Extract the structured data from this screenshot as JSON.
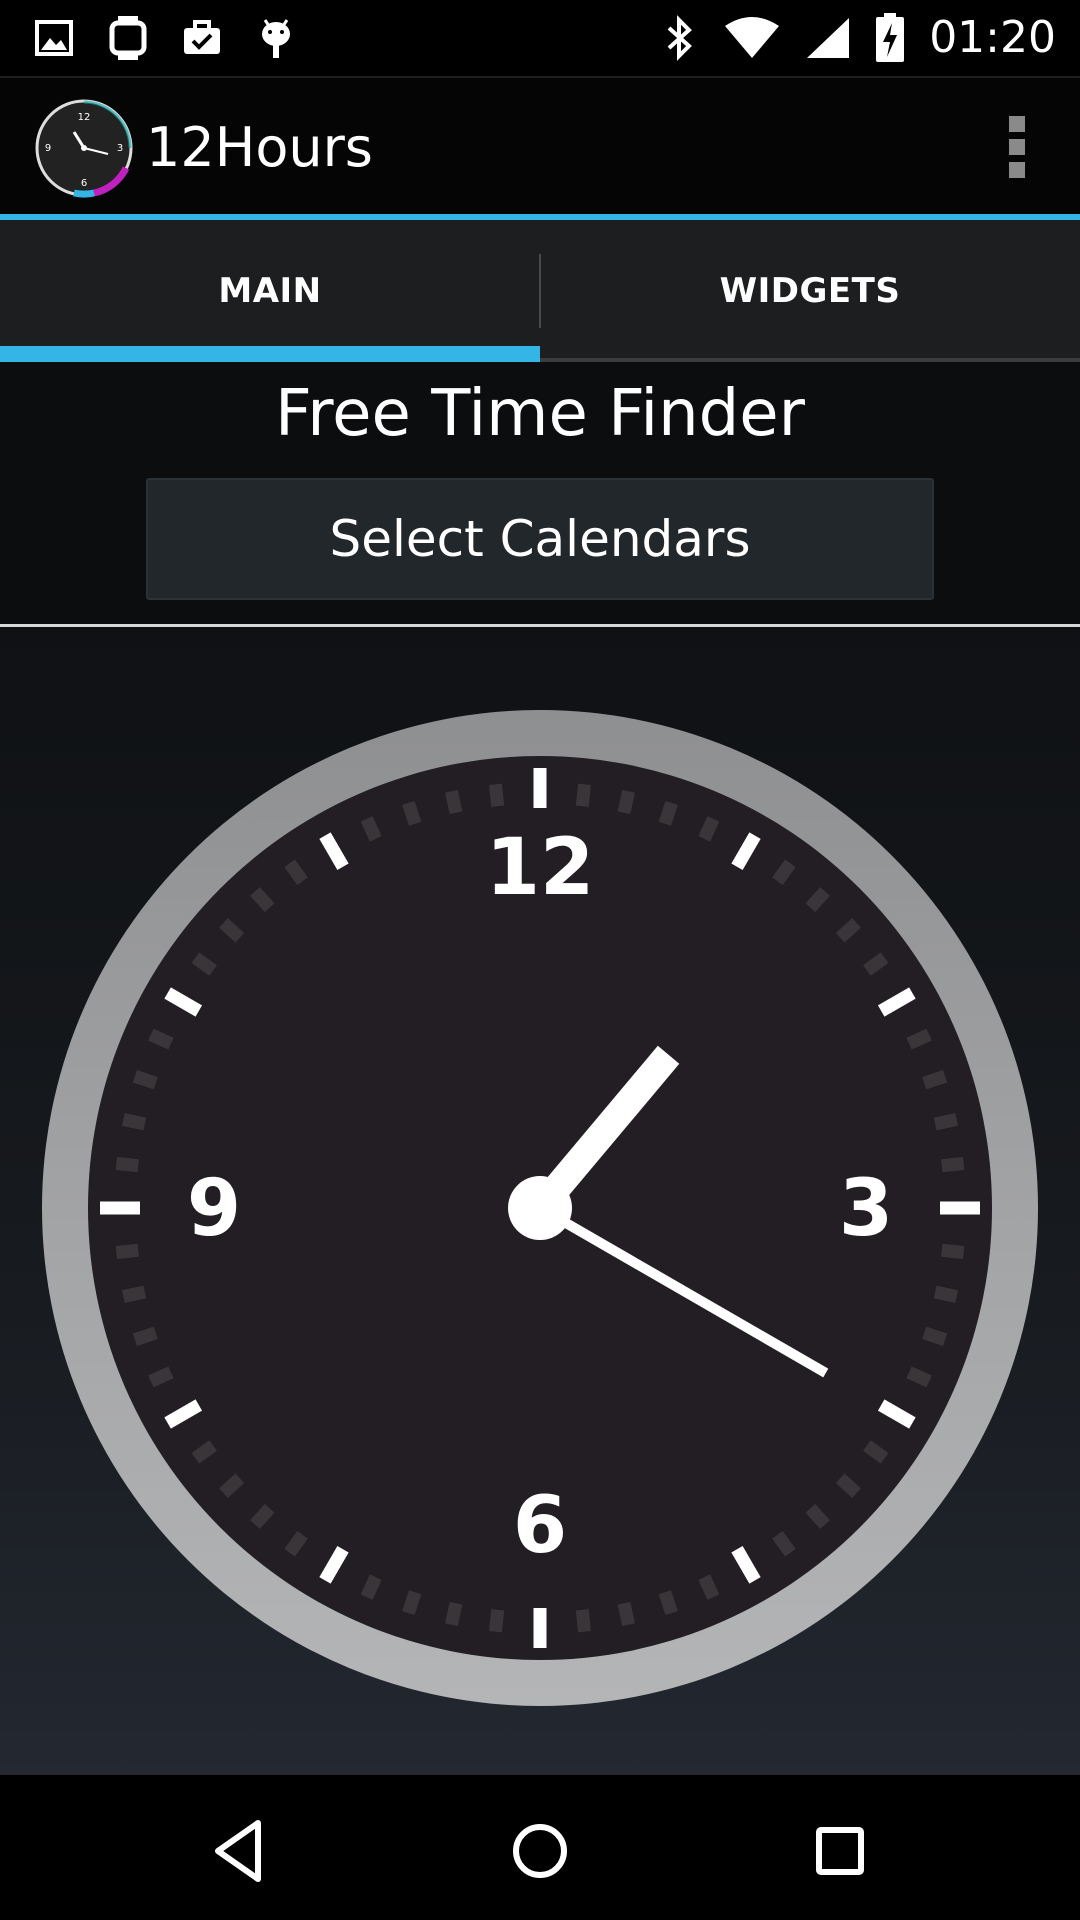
{
  "status_bar": {
    "time": "01:20",
    "left_icons": [
      "image-icon",
      "watch-icon",
      "briefcase-check-icon",
      "android-debug-icon"
    ],
    "right_icons": [
      "bluetooth-icon",
      "wifi-icon",
      "cellular-signal-icon",
      "battery-charging-icon"
    ]
  },
  "action_bar": {
    "title": "12Hours",
    "logo_icon": "clock-logo-icon",
    "overflow_icon": "overflow-menu-icon"
  },
  "tabs": [
    {
      "label": "MAIN",
      "selected": true
    },
    {
      "label": "WIDGETS",
      "selected": false
    }
  ],
  "main": {
    "title": "Free Time Finder",
    "select_button_label": "Select Calendars"
  },
  "clock": {
    "numerals": [
      "12",
      "3",
      "6",
      "9"
    ],
    "time_shown": {
      "hour": 1,
      "minute": 20
    }
  },
  "nav_bar": {
    "back_icon": "back-triangle-icon",
    "home_icon": "home-circle-icon",
    "recents_icon": "recents-square-icon"
  },
  "colors": {
    "accent": "#33b5e5",
    "clock_face": "#231e23",
    "clock_bezel": "#9a9a9c"
  }
}
